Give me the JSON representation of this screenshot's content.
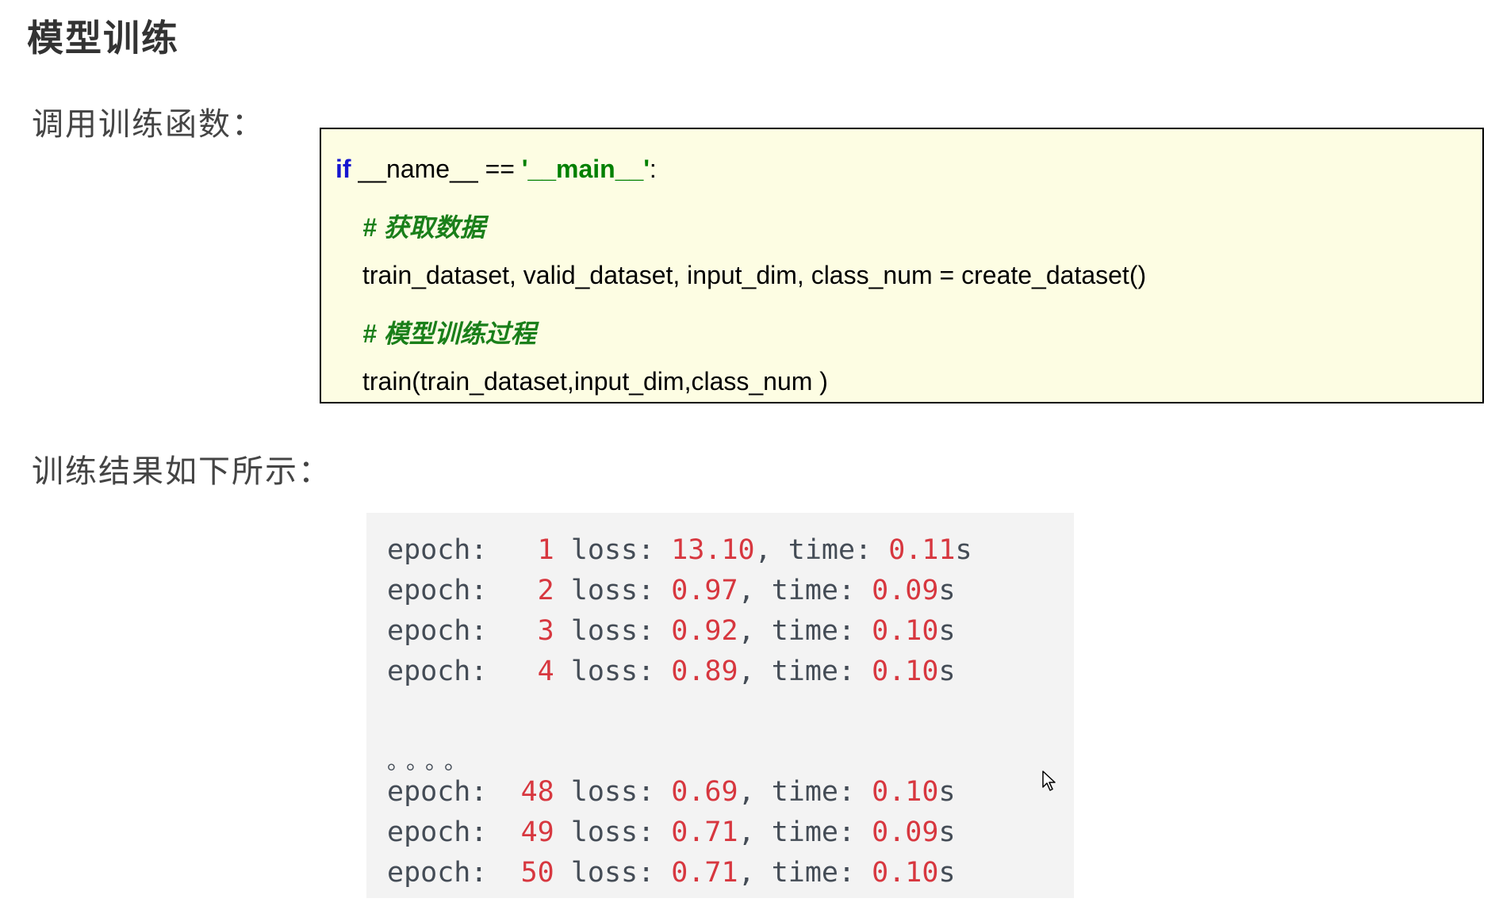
{
  "page": {
    "title": "模型训练",
    "call_label": "调用训练函数：",
    "result_label": "训练结果如下所示："
  },
  "code": {
    "line1": {
      "kw": "if",
      "mid": " __name__ == ",
      "str": "'__main__'",
      "end": ":"
    },
    "comment1": "# 获取数据",
    "line3": "train_dataset, valid_dataset, input_dim, class_num = create_dataset()",
    "comment2": "# 模型训练过程",
    "line5": "train(train_dataset,input_dim,class_num )"
  },
  "output": {
    "epoch_label": "epoch:",
    "loss_label": "loss:",
    "time_label": "time:",
    "ellipsis": "。。。。",
    "rows": [
      {
        "epoch": "1",
        "loss": "13.10",
        "time": "0.11",
        "unit": "s"
      },
      {
        "epoch": "2",
        "loss": "0.97",
        "time": "0.09",
        "unit": "s"
      },
      {
        "epoch": "3",
        "loss": "0.92",
        "time": "0.10",
        "unit": "s"
      },
      {
        "epoch": "4",
        "loss": "0.89",
        "time": "0.10",
        "unit": "s"
      },
      {
        "epoch": "48",
        "loss": "0.69",
        "time": "0.10",
        "unit": "s"
      },
      {
        "epoch": "49",
        "loss": "0.71",
        "time": "0.09",
        "unit": "s"
      },
      {
        "epoch": "50",
        "loss": "0.71",
        "time": "0.10",
        "unit": "s"
      }
    ]
  },
  "icons": {
    "cursor": "mouse-pointer-icon"
  }
}
